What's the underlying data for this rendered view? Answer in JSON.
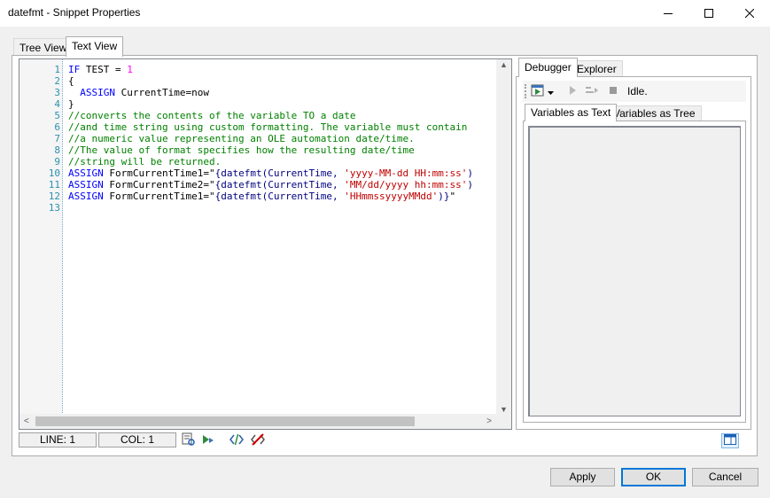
{
  "window": {
    "title": "datefmt - Snippet Properties"
  },
  "tabs": [
    {
      "label": "Tree View"
    },
    {
      "label": "Text View"
    }
  ],
  "editor": {
    "line_numbers": [
      "1",
      "2",
      "3",
      "4",
      "5",
      "6",
      "7",
      "8",
      "9",
      "10",
      "11",
      "12",
      "13"
    ],
    "lines": [
      [
        [
          "kw",
          "IF"
        ],
        [
          "",
          "TEST = "
        ],
        [
          "num",
          "1"
        ]
      ],
      [
        [
          "",
          "{"
        ]
      ],
      [
        [
          "",
          "  "
        ],
        [
          "kw",
          "ASSIGN"
        ],
        [
          "",
          "CurrentTime=now"
        ]
      ],
      [
        [
          "",
          "}"
        ]
      ],
      [
        [
          "cm",
          "//converts the contents of the variable TO a date"
        ]
      ],
      [
        [
          "cm",
          "//and time string using custom formatting. The variable must contain"
        ]
      ],
      [
        [
          "cm",
          "//a numeric value representing an OLE automation date/time."
        ]
      ],
      [
        [
          "cm",
          "//The value of format specifies how the resulting date/time"
        ]
      ],
      [
        [
          "cm",
          "//string will be returned."
        ]
      ],
      [
        [
          "kw",
          "ASSIGN"
        ],
        [
          "",
          " FormCurrentTime1=\""
        ],
        [
          "fn",
          "{datefmt(CurrentTime, "
        ],
        [
          "str",
          "'yyyy-MM-dd HH:mm:ss'"
        ],
        [
          "fn",
          ")"
        ]
      ],
      [
        [
          "kw",
          "ASSIGN"
        ],
        [
          "",
          " FormCurrentTime2=\""
        ],
        [
          "fn",
          "{datefmt(CurrentTime, "
        ],
        [
          "str",
          "'MM/dd/yyyy hh:mm:ss'"
        ],
        [
          "fn",
          ")"
        ]
      ],
      [
        [
          "kw",
          "ASSIGN"
        ],
        [
          "",
          " FormCurrentTime1=\""
        ],
        [
          "fn",
          "{datefmt(CurrentTime, "
        ],
        [
          "str",
          "'HHmmssyyyyMMdd'"
        ],
        [
          "fn",
          ")}"
        ],
        [
          "",
          "\""
        ]
      ],
      [
        [
          "",
          ""
        ]
      ]
    ]
  },
  "status": {
    "line": "LINE: 1",
    "col": "COL: 1"
  },
  "right_panel": {
    "tabs": [
      {
        "label": "Debugger"
      },
      {
        "label": "Explorer"
      }
    ],
    "status_text": "Idle.",
    "sub_tabs": [
      {
        "label": "Variables as Text"
      },
      {
        "label": "Variables as Tree"
      }
    ]
  },
  "buttons": {
    "apply": "Apply",
    "ok": "OK",
    "cancel": "Cancel"
  },
  "colors": {
    "keyword": "#0000ff",
    "number": "#ff00ff",
    "comment": "#008000",
    "string": "#c00000",
    "line_number": "#2b91af",
    "accent": "#0078d7"
  },
  "icons": [
    "minimize-icon",
    "maximize-icon",
    "close-icon",
    "find-icon",
    "run-icon",
    "tag-icon",
    "no-tag-icon",
    "run-debug-icon",
    "dropdown-icon",
    "step-icon",
    "step-over-icon",
    "stop-icon",
    "panel-layout-icon"
  ]
}
